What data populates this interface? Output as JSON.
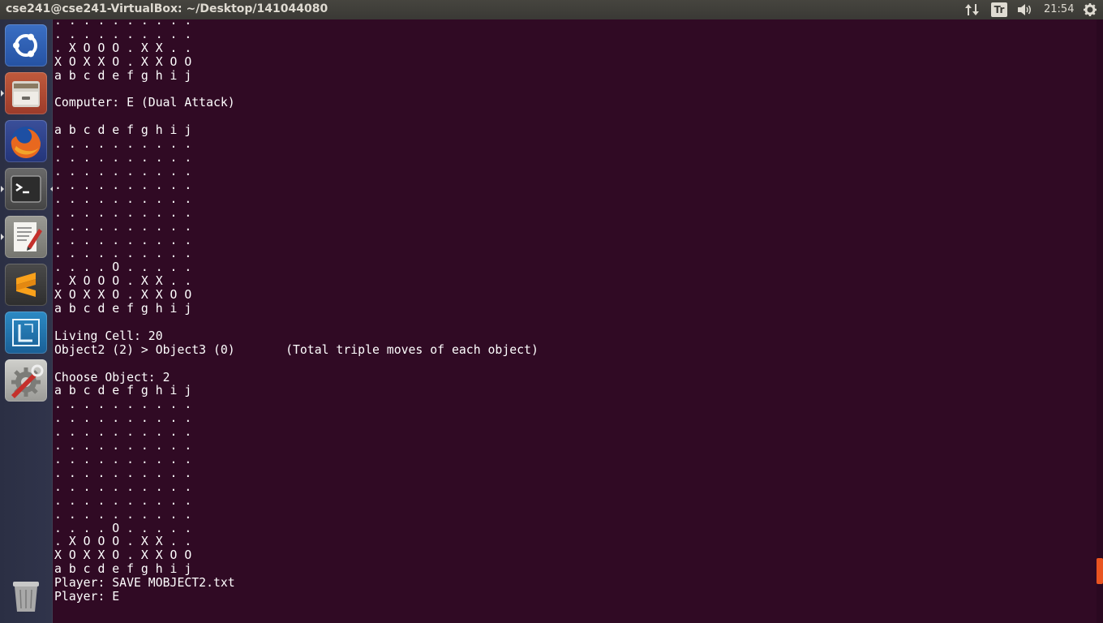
{
  "topbar": {
    "window_title": "cse241@cse241-VirtualBox: ~/Desktop/141044080",
    "network_icon": "updown-arrows-icon",
    "keyboard_layout": "Tr",
    "sound_icon": "speaker-icon",
    "clock": "21:54",
    "settings_icon": "gear-icon"
  },
  "launcher": {
    "items": [
      {
        "name": "ubuntu-dash",
        "icon": "ubuntu-logo-icon"
      },
      {
        "name": "files",
        "icon": "file-cabinet-icon"
      },
      {
        "name": "firefox",
        "icon": "firefox-icon"
      },
      {
        "name": "terminal",
        "icon": "terminal-icon"
      },
      {
        "name": "text-editor",
        "icon": "text-editor-icon"
      },
      {
        "name": "sublime-text",
        "icon": "sublime-text-icon"
      },
      {
        "name": "screenshot",
        "icon": "screenshot-icon"
      },
      {
        "name": "system-settings",
        "icon": "wrench-gear-icon"
      },
      {
        "name": "trash",
        "icon": "trash-icon"
      }
    ]
  },
  "terminal": {
    "lines": [
      ". . . . . . . . . .",
      ". . . . . . . . . .",
      ". X O O O . X X . .",
      "X O X X O . X X O O",
      "a b c d e f g h i j",
      "",
      "Computer: E (Dual Attack)",
      "",
      "a b c d e f g h i j",
      ". . . . . . . . . .",
      ". . . . . . . . . .",
      ". . . . . . . . . .",
      ". . . . . . . . . .",
      ". . . . . . . . . .",
      ". . . . . . . . . .",
      ". . . . . . . . . .",
      ". . . . . . . . . .",
      ". . . . . . . . . .",
      ". . . . O . . . . .",
      ". X O O O . X X . .",
      "X O X X O . X X O O",
      "a b c d e f g h i j",
      "",
      "Living Cell: 20",
      "Object2 (2) > Object3 (0)       (Total triple moves of each object)",
      "",
      "Choose Object: 2",
      "a b c d e f g h i j",
      ". . . . . . . . . .",
      ". . . . . . . . . .",
      ". . . . . . . . . .",
      ". . . . . . . . . .",
      ". . . . . . . . . .",
      ". . . . . . . . . .",
      ". . . . . . . . . .",
      ". . . . . . . . . .",
      ". . . . . . . . . .",
      ". . . . O . . . . .",
      ". X O O O . X X . .",
      "X O X X O . X X O O",
      "a b c d e f g h i j",
      "Player: SAVE MOBJECT2.txt",
      "Player: E"
    ]
  },
  "colors": {
    "terminal_bg": "#300a24",
    "terminal_fg": "#ffffff",
    "panel_bg": "#3a3935",
    "launcher_bg": "#2b2f44",
    "accent": "#e95420"
  }
}
